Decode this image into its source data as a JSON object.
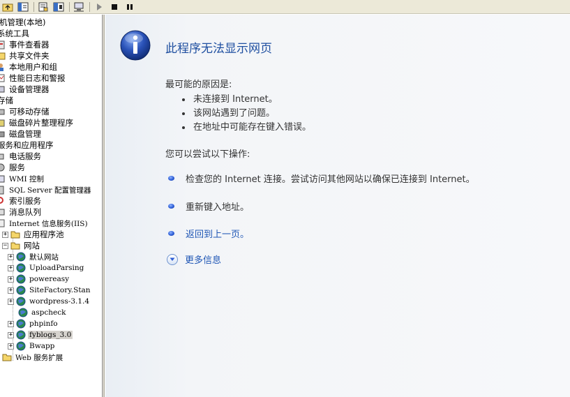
{
  "toolbar": {
    "buttons": [
      "up-folder",
      "show-hide-tree",
      "properties",
      "help",
      "computer",
      "play",
      "stop",
      "pause"
    ]
  },
  "tree": {
    "items": [
      {
        "label": "机管理(本地)"
      },
      {
        "label": "系统工具"
      },
      {
        "label": "事件查看器"
      },
      {
        "label": "共享文件夹"
      },
      {
        "label": "本地用户和组"
      },
      {
        "label": "性能日志和警报"
      },
      {
        "label": "设备管理器"
      },
      {
        "label": "存储"
      },
      {
        "label": "可移动存储"
      },
      {
        "label": "磁盘碎片整理程序"
      },
      {
        "label": "磁盘管理"
      },
      {
        "label": "服务和应用程序"
      },
      {
        "label": "电话服务"
      },
      {
        "label": "服务"
      },
      {
        "label": "WMI 控制"
      },
      {
        "label": "SQL Server 配置管理器"
      },
      {
        "label": "索引服务"
      },
      {
        "label": "消息队列"
      },
      {
        "label": "Internet 信息服务(IIS)"
      },
      {
        "label": "应用程序池"
      },
      {
        "label": "网站"
      },
      {
        "label": "默认网站"
      },
      {
        "label": "UploadParsing"
      },
      {
        "label": "powereasy"
      },
      {
        "label": "SiteFactory.Stan"
      },
      {
        "label": "wordpress-3.1.4"
      },
      {
        "label": "aspcheck"
      },
      {
        "label": "phpinfo"
      },
      {
        "label": "fyblogs_3.0"
      },
      {
        "label": "Bwapp"
      },
      {
        "label": "Web 服务扩展"
      }
    ],
    "selected": "fyblogs_3.0"
  },
  "page": {
    "title": "此程序无法显示网页",
    "causes_heading": "最可能的原因是:",
    "causes": [
      "未连接到 Internet。",
      "该网站遇到了问题。",
      "在地址中可能存在键入错误。"
    ],
    "actions_heading": "您可以尝试以下操作:",
    "action_check": "检查您的 Internet 连接。尝试访问其他网站以确保已连接到 Internet。",
    "action_retype": "重新键入地址。",
    "action_back": "返回到上一页。",
    "more_info": "更多信息"
  },
  "colors": {
    "title_blue": "#1f4fa0",
    "link_blue": "#1f56b5",
    "icon_blue": "#2a52b8"
  }
}
